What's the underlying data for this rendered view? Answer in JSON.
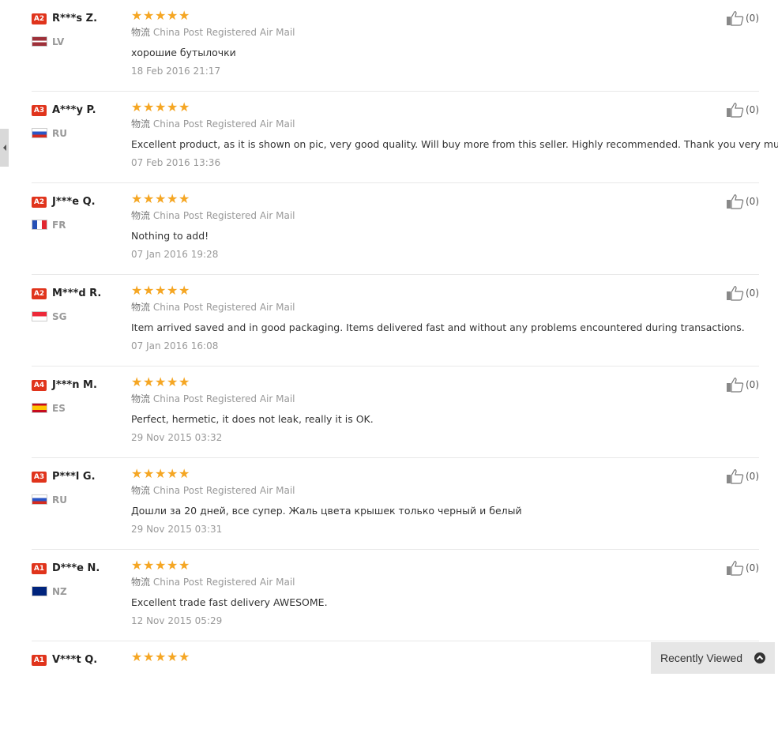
{
  "reviews": [
    {
      "level": "A2",
      "name": "R***s Z.",
      "country": "LV",
      "shipping": "China Post Registered Air Mail",
      "comment": "хорошие бутылочки",
      "date": "18 Feb 2016 21:17",
      "helpful": "(0)",
      "rating": 5
    },
    {
      "level": "A3",
      "name": "A***y P.",
      "country": "RU",
      "shipping": "China Post Registered Air Mail",
      "comment": "Excellent product, as it is shown on pic, very good quality. Will buy more from this seller. Highly recommended. Thank you very much.",
      "date": "07 Feb 2016 13:36",
      "helpful": "(0)",
      "rating": 5
    },
    {
      "level": "A2",
      "name": "J***e Q.",
      "country": "FR",
      "shipping": "China Post Registered Air Mail",
      "comment": "Nothing to add!",
      "date": "07 Jan 2016 19:28",
      "helpful": "(0)",
      "rating": 5
    },
    {
      "level": "A2",
      "name": "M***d R.",
      "country": "SG",
      "shipping": "China Post Registered Air Mail",
      "comment": "Item arrived saved and in good packaging. Items delivered fast and without any problems encountered during transactions.",
      "date": "07 Jan 2016 16:08",
      "helpful": "(0)",
      "rating": 5
    },
    {
      "level": "A4",
      "name": "J***n M.",
      "country": "ES",
      "shipping": "China Post Registered Air Mail",
      "comment": "Perfect, hermetic, it does not leak, really it is OK.",
      "date": "29 Nov 2015 03:32",
      "helpful": "(0)",
      "rating": 5
    },
    {
      "level": "A3",
      "name": "P***l G.",
      "country": "RU",
      "shipping": "China Post Registered Air Mail",
      "comment": "Дошли за 20 дней, все супер. Жаль цвета крышек только черный и белый",
      "date": "29 Nov 2015 03:31",
      "helpful": "(0)",
      "rating": 5
    },
    {
      "level": "A1",
      "name": "D***e N.",
      "country": "NZ",
      "shipping": "China Post Registered Air Mail",
      "comment": "Excellent trade fast delivery AWESOME.",
      "date": "12 Nov 2015 05:29",
      "helpful": "(0)",
      "rating": 5
    },
    {
      "level": "A1",
      "name": "V***t Q.",
      "country": "",
      "shipping": "",
      "comment": "",
      "date": "",
      "helpful": "",
      "rating": 5
    }
  ],
  "logistics_label": "物流",
  "recently_viewed": "Recently Viewed",
  "colors": {
    "level_badge": "#e0341c",
    "star": "#f5a623"
  },
  "icons": {
    "helpful": "thumbs-up-icon",
    "recently": "chevron-up-icon",
    "side": "collapse-arrow-icon"
  }
}
